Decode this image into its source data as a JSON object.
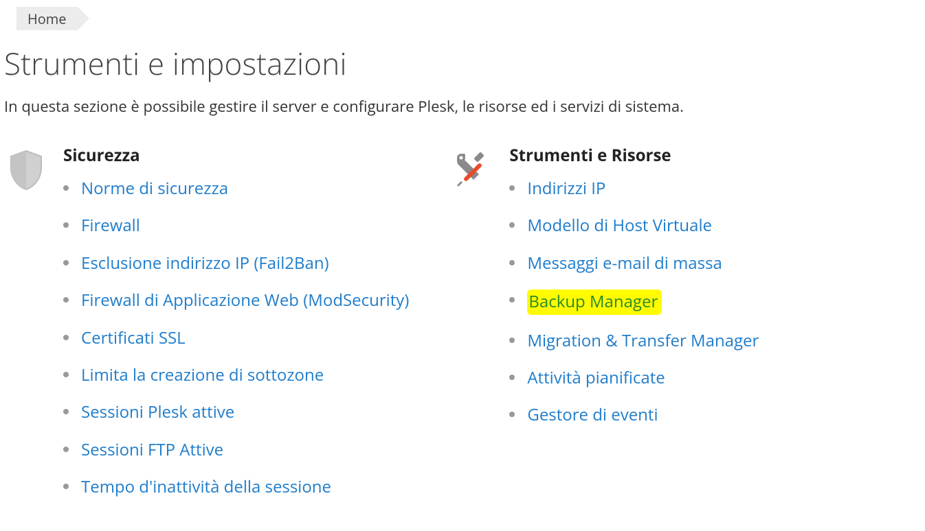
{
  "breadcrumb": {
    "home": "Home"
  },
  "page": {
    "title": "Strumenti e impostazioni",
    "description": "In questa sezione è possibile gestire il server e configurare Plesk, le risorse ed i servizi di sistema."
  },
  "sections": {
    "security": {
      "title": "Sicurezza",
      "items": [
        "Norme di sicurezza",
        "Firewall",
        "Esclusione indirizzo IP (Fail2Ban)",
        "Firewall di Applicazione Web (ModSecurity)",
        "Certificati SSL",
        "Limita la creazione di sottozone",
        "Sessioni Plesk attive",
        "Sessioni FTP Attive",
        "Tempo d'inattività della sessione"
      ]
    },
    "tools": {
      "title": "Strumenti e Risorse",
      "items": [
        "Indirizzi IP",
        "Modello di Host Virtuale",
        "Messaggi e-mail di massa",
        "Backup Manager",
        "Migration & Transfer Manager",
        "Attività pianificate",
        "Gestore di eventi"
      ],
      "highlighted_index": 3
    }
  }
}
